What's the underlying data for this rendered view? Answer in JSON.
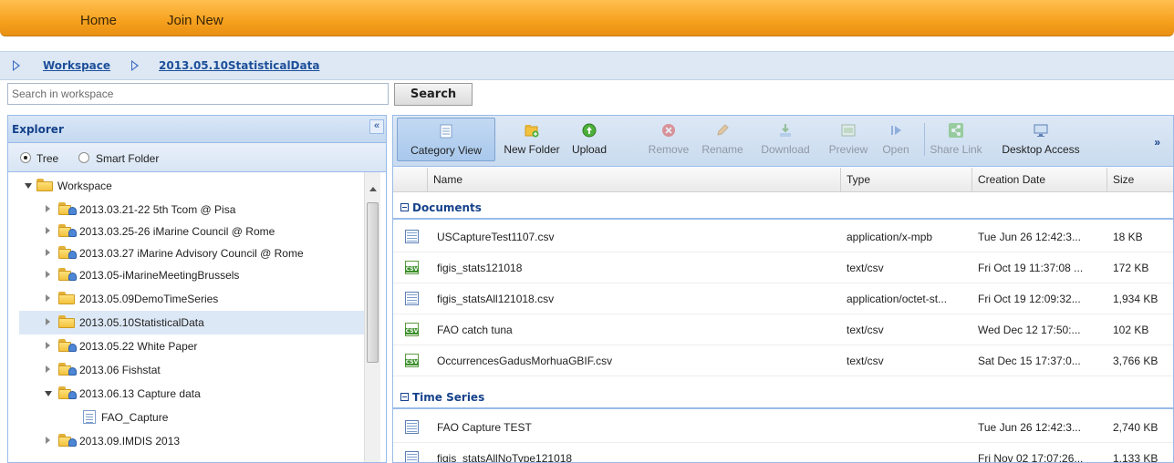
{
  "nav": {
    "home": "Home",
    "join": "Join New"
  },
  "breadcrumb": {
    "items": [
      "Workspace",
      "2013.05.10StatisticalData"
    ]
  },
  "search": {
    "placeholder": "Search in workspace",
    "button": "Search"
  },
  "explorer": {
    "title": "Explorer",
    "collapse": "«",
    "view_options": [
      "Tree",
      "Smart Folder"
    ],
    "selected_view": "Tree",
    "tree": [
      {
        "label": "Workspace",
        "expanded": true,
        "icon": "folder-icon"
      },
      {
        "label": "2013.03.21-22 5th Tcom @ Pisa",
        "icon": "shared-folder-icon"
      },
      {
        "label": "2013.03.25-26 iMarine Council @ Rome",
        "icon": "shared-folder-icon"
      },
      {
        "label": "2013.03.27 iMarine Advisory Council @ Rome",
        "icon": "shared-folder-icon"
      },
      {
        "label": "2013.05-iMarineMeetingBrussels",
        "icon": "shared-folder-icon"
      },
      {
        "label": "2013.05.09DemoTimeSeries",
        "icon": "folder-icon"
      },
      {
        "label": "2013.05.10StatisticalData",
        "icon": "folder-icon",
        "selected": true
      },
      {
        "label": "2013.05.22 White Paper",
        "icon": "shared-folder-icon"
      },
      {
        "label": "2013.06 Fishstat",
        "icon": "shared-folder-icon"
      },
      {
        "label": "2013.06.13 Capture data",
        "icon": "shared-folder-icon",
        "expanded": true
      },
      {
        "label": "FAO_Capture",
        "icon": "table-icon"
      },
      {
        "label": "2013.09.IMDIS 2013",
        "icon": "shared-folder-icon"
      }
    ]
  },
  "toolbar": {
    "buttons": [
      {
        "label": "Category View",
        "icon": "category-view-icon",
        "enabled": true,
        "active": true
      },
      {
        "label": "New Folder",
        "icon": "new-folder-icon",
        "enabled": true
      },
      {
        "label": "Upload",
        "icon": "upload-icon",
        "enabled": true
      },
      {
        "label": "Remove",
        "icon": "remove-icon",
        "enabled": false
      },
      {
        "label": "Rename",
        "icon": "rename-icon",
        "enabled": false
      },
      {
        "label": "Download",
        "icon": "download-icon",
        "enabled": false
      },
      {
        "label": "Preview",
        "icon": "preview-icon",
        "enabled": false
      },
      {
        "label": "Open",
        "icon": "open-icon",
        "enabled": false
      },
      {
        "label": "Share Link",
        "icon": "share-link-icon",
        "enabled": false
      },
      {
        "label": "Desktop Access",
        "icon": "desktop-access-icon",
        "enabled": true
      }
    ],
    "more": "»"
  },
  "grid": {
    "columns": [
      "Name",
      "Type",
      "Creation Date",
      "Size"
    ],
    "groups": [
      {
        "label": "Documents",
        "rows": [
          {
            "name": "USCaptureTest1107.csv",
            "type": "application/x-mpb",
            "date": "Tue Jun 26 12:42:3...",
            "size": "18 KB",
            "icon": "table-icon"
          },
          {
            "name": "figis_stats121018",
            "type": "text/csv",
            "date": "Fri Oct 19 11:37:08 ...",
            "size": "172 KB",
            "icon": "csv-icon"
          },
          {
            "name": "figis_statsAll121018.csv",
            "type": "application/octet-st...",
            "date": "Fri Oct 19 12:09:32...",
            "size": "1,934 KB",
            "icon": "table-icon"
          },
          {
            "name": "FAO catch tuna",
            "type": "text/csv",
            "date": "Wed Dec 12 17:50:...",
            "size": "102 KB",
            "icon": "csv-icon"
          },
          {
            "name": "OccurrencesGadusMorhuaGBIF.csv",
            "type": "text/csv",
            "date": "Sat Dec 15 17:37:0...",
            "size": "3,766 KB",
            "icon": "csv-icon"
          }
        ]
      },
      {
        "label": "Time Series",
        "rows": [
          {
            "name": "FAO Capture TEST",
            "type": "",
            "date": "Tue Jun 26 12:42:3...",
            "size": "2,740 KB",
            "icon": "table-icon"
          },
          {
            "name": "figis_statsAllNoType121018",
            "type": "",
            "date": "Fri Nov 02 17:07:26...",
            "size": "1,133 KB",
            "icon": "table-icon"
          }
        ]
      }
    ]
  },
  "colors": {
    "nav_orange": "#f6a11e",
    "header_blue": "#15428b",
    "panel_border": "#99bbe8"
  }
}
